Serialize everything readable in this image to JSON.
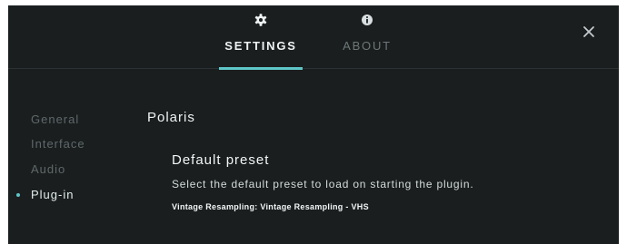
{
  "header": {
    "tabs": [
      {
        "label": "SETTINGS",
        "icon": "gear-icon",
        "active": true
      },
      {
        "label": "ABOUT",
        "icon": "info-icon",
        "active": false
      }
    ],
    "close_icon": "close-icon"
  },
  "sidebar": {
    "items": [
      {
        "label": "General",
        "active": false
      },
      {
        "label": "Interface",
        "active": false
      },
      {
        "label": "Audio",
        "active": false
      },
      {
        "label": "Plug-in",
        "active": true
      }
    ]
  },
  "main": {
    "title": "Polaris",
    "section": {
      "title": "Default preset",
      "description": "Select the default preset to load on starting the plugin.",
      "value": "Vintage Resampling: Vintage Resampling - VHS"
    }
  },
  "colors": {
    "background": "#1a1e1f",
    "accent": "#5fc6c8",
    "muted_text": "#5f6869"
  }
}
